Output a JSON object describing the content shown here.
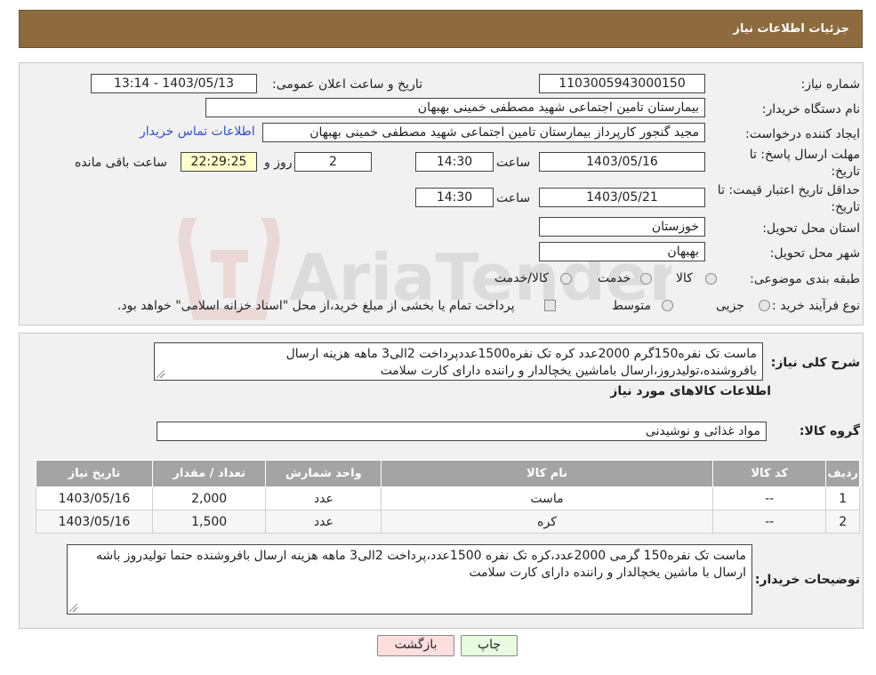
{
  "header": {
    "title": "جزئیات اطلاعات نیاز"
  },
  "form": {
    "need_number_label": "شماره نیاز:",
    "need_number": "1103005943000150",
    "announce_label": "تاریخ و ساعت اعلان عمومی:",
    "announce_value": "1403/05/13 - 13:14",
    "buyer_org_label": "نام دستگاه خریدار:",
    "buyer_org": "بیمارستان تامین اجتماعی شهید مصطفی خمینی بهبهان",
    "creator_label": "ایجاد کننده درخواست:",
    "creator": "مجید گنجور کارپرداز بیمارستان تامین اجتماعی شهید مصطفی خمینی بهبهان",
    "contact_link": "اطلاعات تماس خریدار",
    "reply_deadline_label_1": "مهلت ارسال پاسخ: تا",
    "reply_deadline_label_2": "تاریخ:",
    "reply_date": "1403/05/16",
    "time_label": "ساعت",
    "reply_time": "14:30",
    "days_value": "2",
    "days_label": "روز و",
    "remaining_value": "22:29:25",
    "remaining_label": "ساعت باقی مانده",
    "price_validity_label_1": "حداقل تاریخ اعتبار قیمت: تا",
    "price_validity_label_2": "تاریخ:",
    "price_date": "1403/05/21",
    "price_time": "14:30",
    "province_label": "استان محل تحویل:",
    "province": "خوزستان",
    "city_label": "شهر محل تحویل:",
    "city": "بهبهان",
    "category_label": "طبقه بندی موضوعی:",
    "category_options": [
      "کالا",
      "خدمت",
      "کالا/خدمت"
    ],
    "process_label": "نوع فرآیند خرید :",
    "process_options": [
      "جزیی",
      "متوسط"
    ],
    "process_note": "پرداخت تمام یا بخشی از مبلغ خرید،از محل \"اسناد خزانه اسلامی\" خواهد بود."
  },
  "description": {
    "label": "شرح کلی نیاز:",
    "text": "ماست تک نفره150گرم 2000عدد کره تک نفره1500عددپرداخت 2الی3 ماهه هزینه ارسال بافروشنده،تولیدروز،ارسال باماشین یخچالدار و راننده دارای کارت سلامت"
  },
  "goods": {
    "section_title": "اطلاعات کالاهای مورد نیاز",
    "group_label": "گروه کالا:",
    "group_value": "مواد غذائی و نوشیدنی",
    "columns": [
      "ردیف",
      "کد کالا",
      "نام کالا",
      "واحد شمارش",
      "تعداد / مقدار",
      "تاریخ نیاز"
    ],
    "rows": [
      [
        "1",
        "--",
        "ماست",
        "عدد",
        "2,000",
        "1403/05/16"
      ],
      [
        "2",
        "--",
        "کره",
        "عدد",
        "1,500",
        "1403/05/16"
      ]
    ]
  },
  "buyer_notes": {
    "label": "توضیحات خریدار:",
    "text": "ماست تک نفره150 گرمی 2000عدد،کره تک نفره 1500عدد،پرداخت 2الی3 ماهه هزینه ارسال بافروشنده حتما تولیدروز باشه ارسال با ماشین یخچالدار و راننده دارای کارت سلامت"
  },
  "buttons": {
    "print": "چاپ",
    "back": "بازگشت"
  },
  "watermark": "AriaTender.neT",
  "colors": {
    "header": "#8d6b3e",
    "link": "#2f4fd8",
    "print_btn": "#e6fbe0",
    "back_btn": "#ffdede"
  }
}
